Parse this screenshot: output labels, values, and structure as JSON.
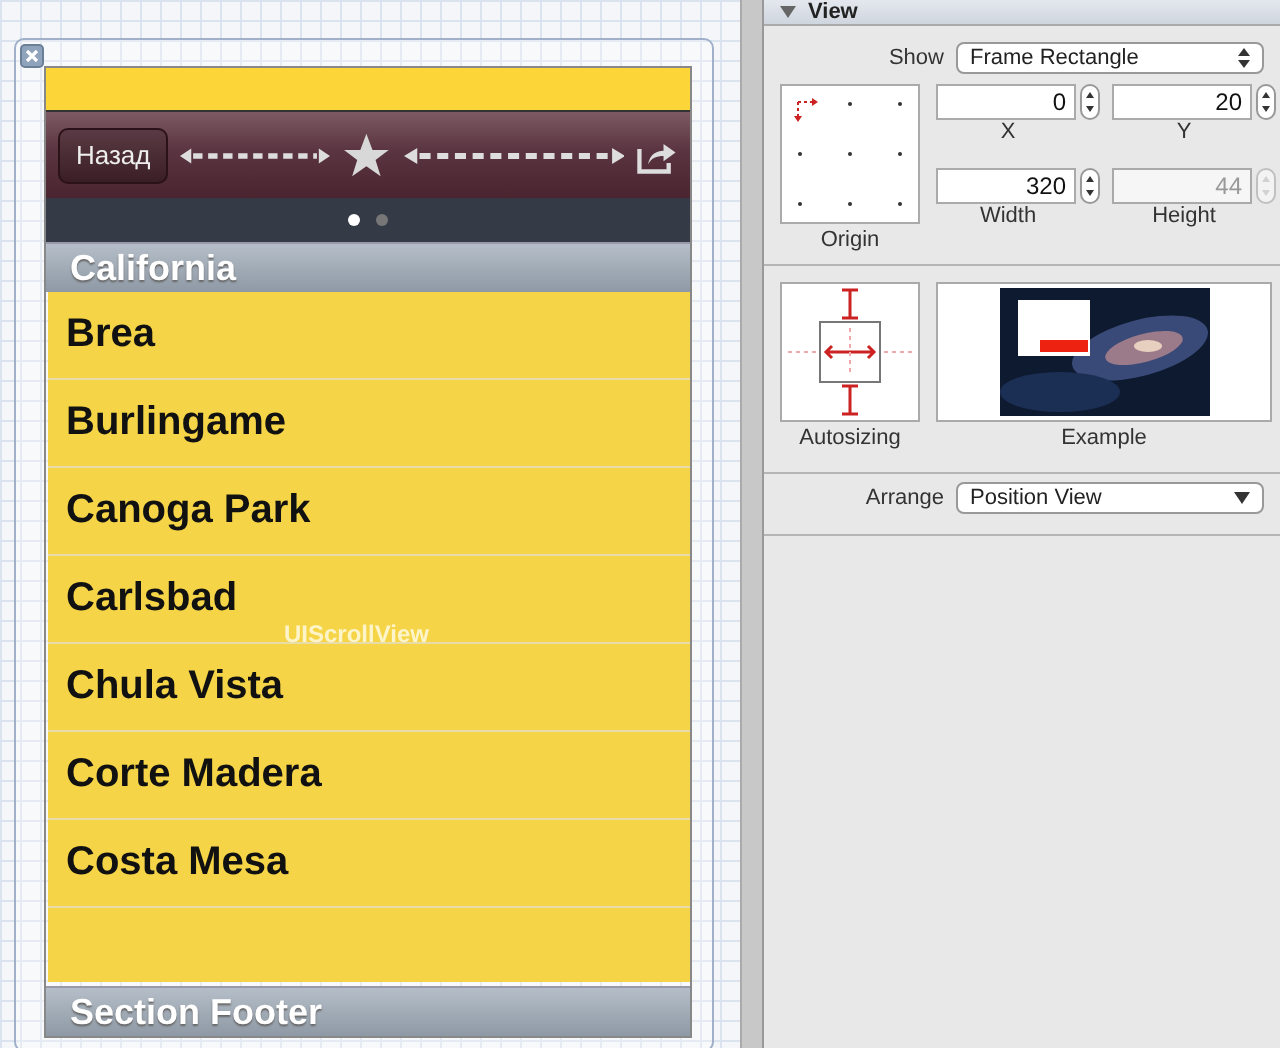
{
  "canvas": {
    "overlay_label": "UIScrollView"
  },
  "toolbar": {
    "back_button": "Назад"
  },
  "page_control": {
    "pages": [
      {
        "selected": true
      },
      {
        "selected": false
      }
    ]
  },
  "section_header": "California",
  "rows": [
    "Brea",
    "Burlingame",
    "Canoga Park",
    "Carlsbad",
    "Chula Vista",
    "Corte Madera",
    "Costa Mesa"
  ],
  "section_footer": "Section Footer",
  "inspector": {
    "section": {
      "title": "View",
      "expanded": true
    },
    "show": {
      "label": "Show",
      "value": "Frame Rectangle"
    },
    "origin_label": "Origin",
    "fields": [
      {
        "label": "X",
        "value": "0",
        "disabled": false
      },
      {
        "label": "Y",
        "value": "20",
        "disabled": false
      },
      {
        "label": "Width",
        "value": "320",
        "disabled": false
      },
      {
        "label": "Height",
        "value": "44",
        "disabled": true
      }
    ],
    "autosizing_label": "Autosizing",
    "example_label": "Example",
    "arrange": {
      "label": "Arrange",
      "value": "Position View"
    }
  }
}
